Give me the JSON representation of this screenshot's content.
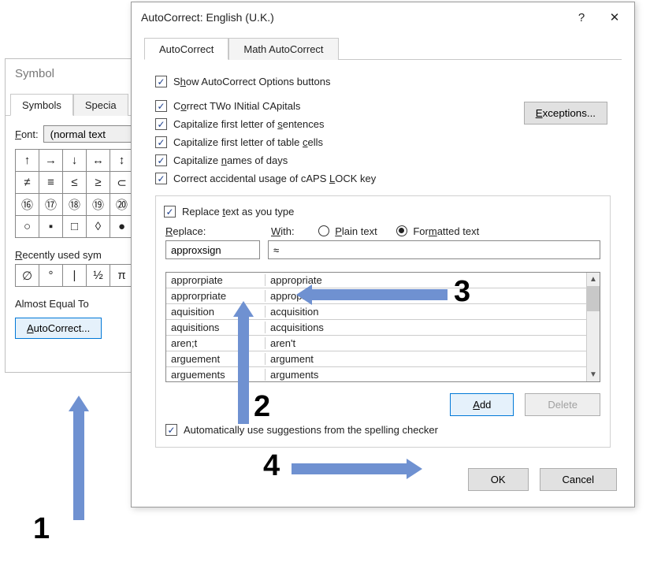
{
  "symbol": {
    "title": "Symbol",
    "tabs": [
      "Symbols",
      "Specia"
    ],
    "font_label": "Font:",
    "font_value": "(normal text",
    "grid": [
      "↑",
      "→",
      "↓",
      "↔",
      "↕",
      "≠",
      "≡",
      "≤",
      "≥",
      "⊂",
      "⑯",
      "⑰",
      "⑱",
      "⑲",
      "⑳",
      "○",
      "▪",
      "□",
      "◊",
      "●"
    ],
    "recent_label": "Recently used sym",
    "recent": [
      "∅",
      "°",
      "|",
      "½",
      "π"
    ],
    "almost_label": "Almost Equal To",
    "autocorrect_btn": "AutoCorrect..."
  },
  "ac": {
    "title": "AutoCorrect: English (U.K.)",
    "help": "?",
    "close": "✕",
    "tabs": [
      "AutoCorrect",
      "Math AutoCorrect"
    ],
    "chk_show": "Show AutoCorrect Options buttons",
    "chk_two": "Correct TWo INitial CApitals",
    "chk_sent": "Capitalize first letter of sentences",
    "chk_cells": "Capitalize first letter of table cells",
    "chk_days": "Capitalize names of days",
    "chk_caps": "Correct accidental usage of cAPS LOCK key",
    "exceptions": "Exceptions...",
    "chk_replace": "Replace text as you type",
    "lbl_replace": "Replace:",
    "lbl_with": "With:",
    "radio_plain": "Plain text",
    "radio_formatted": "Formatted text",
    "in_replace": "approxsign",
    "in_with": "≈",
    "list": [
      {
        "r": "approrpiate",
        "w": "appropriate"
      },
      {
        "r": "approrpriate",
        "w": "appropriate"
      },
      {
        "r": "aquisition",
        "w": "acquisition"
      },
      {
        "r": "aquisitions",
        "w": "acquisitions"
      },
      {
        "r": "aren;t",
        "w": "aren't"
      },
      {
        "r": "arguement",
        "w": "argument"
      },
      {
        "r": "arguements",
        "w": "arguments"
      }
    ],
    "add": "Add",
    "delete": "Delete",
    "chk_suggest": "Automatically use suggestions from the spelling checker",
    "ok": "OK",
    "cancel": "Cancel"
  },
  "annotations": {
    "n1": "1",
    "n2": "2",
    "n3": "3",
    "n4": "4"
  }
}
